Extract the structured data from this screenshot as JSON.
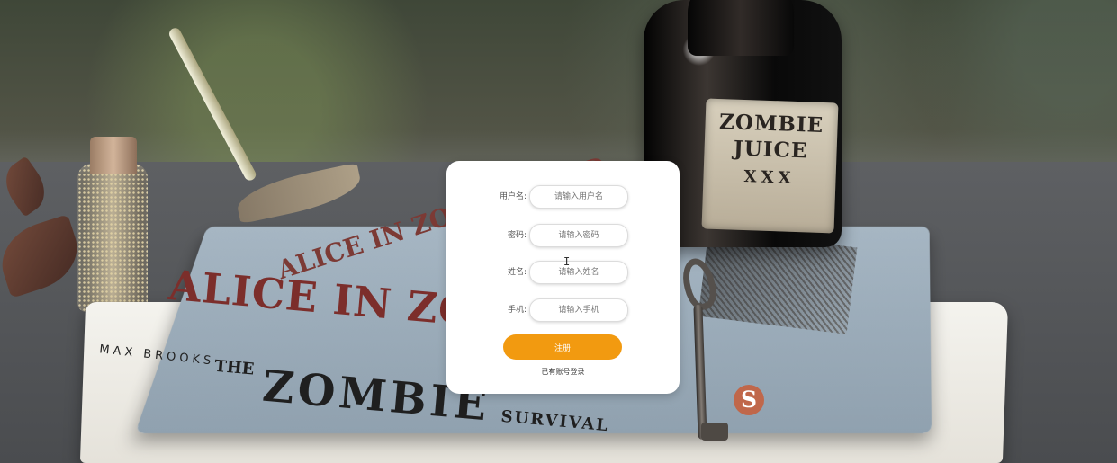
{
  "registration_form": {
    "fields": [
      {
        "label": "用户名:",
        "placeholder": "请输入用户名"
      },
      {
        "label": "密码:",
        "placeholder": "请输入密码"
      },
      {
        "label": "姓名:",
        "placeholder": "请输入姓名"
      },
      {
        "label": "手机:",
        "placeholder": "请输入手机"
      }
    ],
    "submit_label": "注册",
    "login_link_label": "已有账号登录"
  },
  "background_text": {
    "book_top_title": "ALICE IN ZOM",
    "book_top_upside_title": "ALICE IN ZOMBIELAND",
    "book_bottom_author": "MAX BROOKS",
    "book_bottom_title_small": "THE",
    "book_bottom_title_main": "ZOMBIE",
    "book_bottom_title_tail": "SURVIVAL",
    "bottle_label_line1": "ZOMBIE",
    "bottle_label_line2": "JUICE",
    "bottle_label_line3": "XXX"
  },
  "icons": {
    "text_cursor": "text-cursor-icon"
  },
  "colors": {
    "primary_button": "#f29a10",
    "card_background": "#ffffff"
  }
}
